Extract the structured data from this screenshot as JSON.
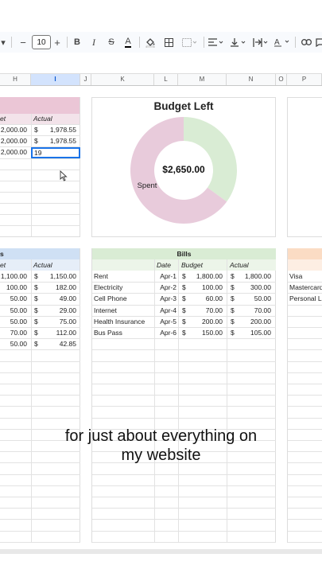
{
  "toolbar": {
    "font_size": "10",
    "minus": "−",
    "plus": "+",
    "bold": "B",
    "italic": "I",
    "strike": "S",
    "text_color_glyph": "A",
    "icons": [
      "paint-bucket-icon",
      "borders-icon",
      "merge-cells-icon",
      "align-left-icon",
      "vertical-align-icon",
      "text-wrap-icon",
      "text-rotation-icon",
      "link-icon",
      "comment-icon"
    ]
  },
  "columns": [
    "H",
    "I",
    "J",
    "K",
    "L",
    "M",
    "N",
    "O",
    "P"
  ],
  "income": {
    "header_left": "et",
    "header_right": "Actual",
    "rows": [
      {
        "budget": "2,000.00",
        "cur": "$",
        "actual": "1,978.55"
      },
      {
        "budget": "2,000.00",
        "cur": "$",
        "actual": "1,978.55"
      },
      {
        "budget": "2,000.00",
        "cur": "",
        "actual": ""
      }
    ],
    "editing_value": "19"
  },
  "chart": {
    "title": "Budget Left",
    "center_value": "$2,650.00",
    "slice_label": "Spent",
    "colors": {
      "spent": "#e8cbdb",
      "left": "#d9ecd4"
    }
  },
  "chart_data": {
    "type": "pie",
    "title": "Budget Left",
    "slices": [
      {
        "label": "Spent",
        "value": 0.65
      },
      {
        "label": "",
        "value": 0.35
      }
    ]
  },
  "expenses": {
    "title": "s",
    "header_left": "et",
    "header_right": "Actual",
    "rows": [
      {
        "budget": "1,100.00",
        "cur": "$",
        "actual": "1,150.00"
      },
      {
        "budget": "100.00",
        "cur": "$",
        "actual": "182.00"
      },
      {
        "budget": "50.00",
        "cur": "$",
        "actual": "49.00"
      },
      {
        "budget": "50.00",
        "cur": "$",
        "actual": "29.00"
      },
      {
        "budget": "50.00",
        "cur": "$",
        "actual": "75.00"
      },
      {
        "budget": "70.00",
        "cur": "$",
        "actual": "112.00"
      },
      {
        "budget": "50.00",
        "cur": "$",
        "actual": "42.85"
      }
    ]
  },
  "bills": {
    "title": "Bills",
    "headers": {
      "date": "Date",
      "budget": "Budget",
      "actual": "Actual"
    },
    "rows": [
      {
        "name": "Rent",
        "date": "Apr-1",
        "bcur": "$",
        "budget": "1,800.00",
        "acur": "$",
        "actual": "1,800.00"
      },
      {
        "name": "Electricity",
        "date": "Apr-2",
        "bcur": "$",
        "budget": "100.00",
        "acur": "$",
        "actual": "300.00"
      },
      {
        "name": "Cell Phone",
        "date": "Apr-3",
        "bcur": "$",
        "budget": "60.00",
        "acur": "$",
        "actual": "50.00"
      },
      {
        "name": "Internet",
        "date": "Apr-4",
        "bcur": "$",
        "budget": "70.00",
        "acur": "$",
        "actual": "70.00"
      },
      {
        "name": "Health Insurance",
        "date": "Apr-5",
        "bcur": "$",
        "budget": "200.00",
        "acur": "$",
        "actual": "200.00"
      },
      {
        "name": "Bus Pass",
        "date": "Apr-6",
        "bcur": "$",
        "budget": "150.00",
        "acur": "$",
        "actual": "105.00"
      }
    ]
  },
  "cards": {
    "items": [
      "Visa",
      "Mastercard",
      "Personal L"
    ]
  },
  "caption": {
    "line1": "for just about everything on",
    "line2": "my website"
  }
}
